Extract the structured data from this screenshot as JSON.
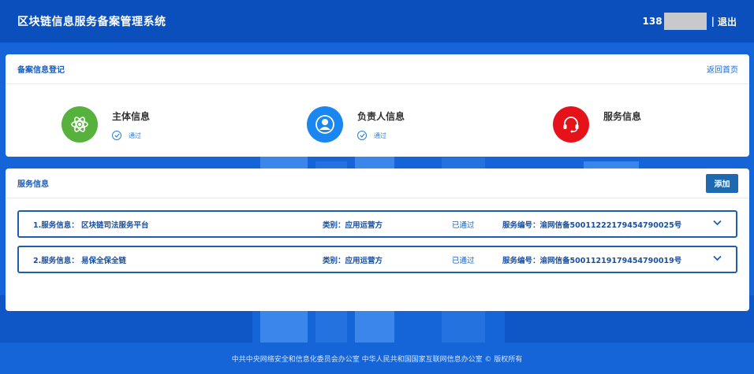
{
  "header": {
    "title": "区块链信息服务备案管理系统",
    "user_phone_prefix": "138",
    "separator": "|",
    "logout_label": "退出"
  },
  "registration": {
    "title": "备案信息登记",
    "back_link": "返回首页",
    "steps": [
      {
        "label": "主体信息",
        "status": "通过",
        "icon": "atom-icon",
        "color": "#56b23c"
      },
      {
        "label": "负责人信息",
        "status": "通过",
        "icon": "person-icon",
        "color": "#1a86f0"
      },
      {
        "label": "服务信息",
        "status": "",
        "icon": "headset-icon",
        "color": "#e5121a"
      }
    ]
  },
  "services": {
    "title": "服务信息",
    "add_label": "添加",
    "items": [
      {
        "name": "1.服务信息：  区块链司法服务平台",
        "category": "类别：应用运营方",
        "status": "已通过",
        "number": "服务编号：渝网信备50011222179454790025号"
      },
      {
        "name": "2.服务信息：  易保全保全链",
        "category": "类别：应用运营方",
        "status": "已通过",
        "number": "服务编号：渝网信备50011219179454790019号"
      }
    ]
  },
  "footer": {
    "text": "中共中央网络安全和信息化委员会办公室   中华人民共和国国家互联网信息办公室 © 版权所有"
  }
}
